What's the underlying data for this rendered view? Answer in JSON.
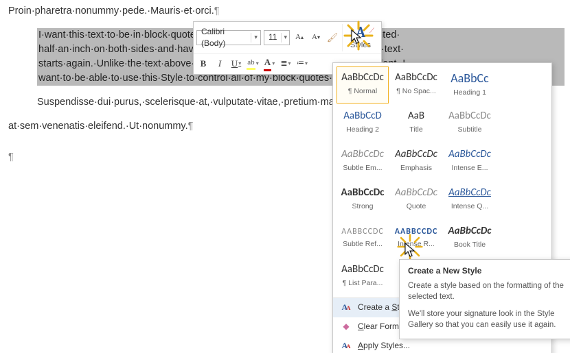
{
  "doc": {
    "line_top": "Proin·pharetra·nonummy·pede.·Mauris·et·orci.",
    "bq": {
      "l1": "I·want·this·text·to·be·in·block·quote·format.·It·will·be·single-spaced·and·indented·",
      "l2": "half·an·inch·on·both·sides·and·have·12·points·of·space·beneath·it·before·the·text·",
      "l3": "starts·again.·Unlike·the·text·above·and·below·it,·it·will·not·have·a·first·line·indent.·I·",
      "l4": "want·to·be·able·to·use·this·Style·to·control·all·of·my·block·quotes·in·the·document.¶"
    },
    "line_after_bq": "Suspendisse·dui·purus,·scelerisque·at,·vulputate·vitae,·pretium·mattis,·nunc.·Mauris·eget·neque·",
    "line_bottom": "at·sem·venenatis·eleifend.·Ut·nonummy."
  },
  "toolbar": {
    "font_name": "Calibri (Body)",
    "font_size": "11",
    "styles_label": "Styles"
  },
  "gallery": {
    "tiles": [
      {
        "preview": "AaBbCcDc",
        "name": "¶ Normal"
      },
      {
        "preview": "AaBbCcDc",
        "name": "¶ No Spac..."
      },
      {
        "preview": "AaBbCc",
        "name": "Heading 1"
      },
      {
        "preview": "AaBbCcD",
        "name": "Heading 2"
      },
      {
        "preview": "AaB",
        "name": "Title"
      },
      {
        "preview": "AaBbCcDc",
        "name": "Subtitle"
      },
      {
        "preview": "AaBbCcDc",
        "name": "Subtle Em..."
      },
      {
        "preview": "AaBbCcDc",
        "name": "Emphasis"
      },
      {
        "preview": "AaBbCcDc",
        "name": "Intense E..."
      },
      {
        "preview": "AaBbCcDc",
        "name": "Strong"
      },
      {
        "preview": "AaBbCcDc",
        "name": "Quote"
      },
      {
        "preview": "AaBbCcDc",
        "name": "Intense Q..."
      },
      {
        "preview": "AABBCCDC",
        "name": "Subtle Ref..."
      },
      {
        "preview": "AABBCCDC",
        "name": "Intense R..."
      },
      {
        "preview": "AaBbCcDc",
        "name": "Book Title"
      },
      {
        "preview": "AaBbCcDc",
        "name": "¶ List Para..."
      }
    ],
    "menu": {
      "create_pre": "Create a ",
      "create_ul": "S",
      "create_post": "tyle",
      "clear_ul": "C",
      "clear_post": "lear Formatting",
      "apply_ul": "A",
      "apply_post": "pply Styles..."
    }
  },
  "tooltip": {
    "title": "Create a New Style",
    "p1": "Create a style based on the formatting of the selected text.",
    "p2": "We'll store your signature look in the Style Gallery so that you can easily use it again."
  }
}
